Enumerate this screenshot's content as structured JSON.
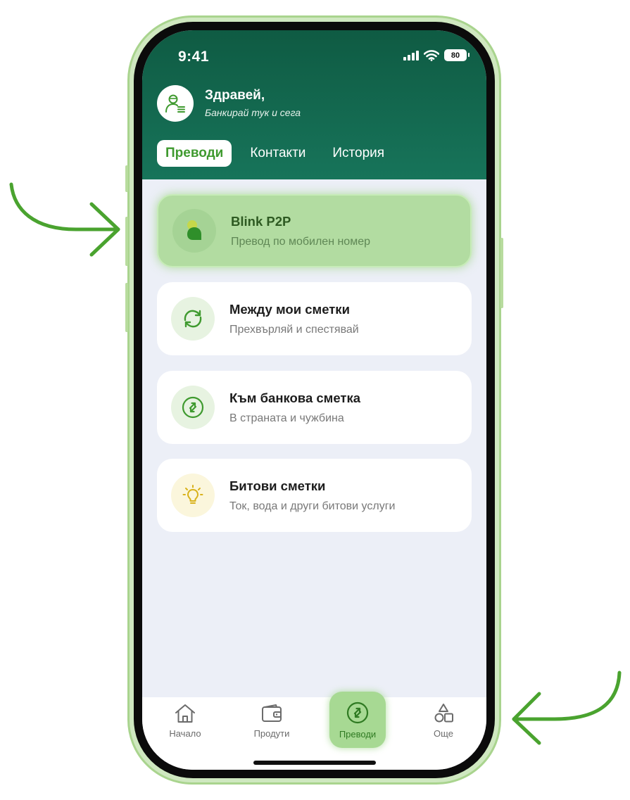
{
  "status_bar": {
    "time": "9:41",
    "battery": "80"
  },
  "header": {
    "greeting": "Здравей,",
    "subtitle": "Банкирай тук и сега",
    "tabs": [
      {
        "label": "Преводи",
        "active": true
      },
      {
        "label": "Контакти",
        "active": false
      },
      {
        "label": "История",
        "active": false
      }
    ]
  },
  "cards": [
    {
      "title": "Blink P2P",
      "subtitle": "Превод по мобилен номер",
      "icon": "blink-p2p-icon",
      "highlighted": true
    },
    {
      "title": "Между мои сметки",
      "subtitle": "Прехвърляй и спестявай",
      "icon": "refresh-icon",
      "highlighted": false
    },
    {
      "title": "Към банкова сметка",
      "subtitle": "В страната и чужбина",
      "icon": "transfer-icon",
      "highlighted": false
    },
    {
      "title": "Битови сметки",
      "subtitle": "Ток, вода и други битови услуги",
      "icon": "lightbulb-icon",
      "highlighted": false
    }
  ],
  "bottom_nav": [
    {
      "label": "Начало",
      "icon": "home-icon",
      "active": false
    },
    {
      "label": "Продути",
      "icon": "wallet-icon",
      "active": false
    },
    {
      "label": "Преводи",
      "icon": "transfer-icon",
      "active": true
    },
    {
      "label": "Още",
      "icon": "shapes-icon",
      "active": false
    }
  ],
  "colors": {
    "header_green": "#0f5b43",
    "accent_green": "#3f9a2f",
    "highlight_green": "#b2dca1",
    "annotation_arrow": "#4aa32f",
    "background": "#eceff7"
  }
}
